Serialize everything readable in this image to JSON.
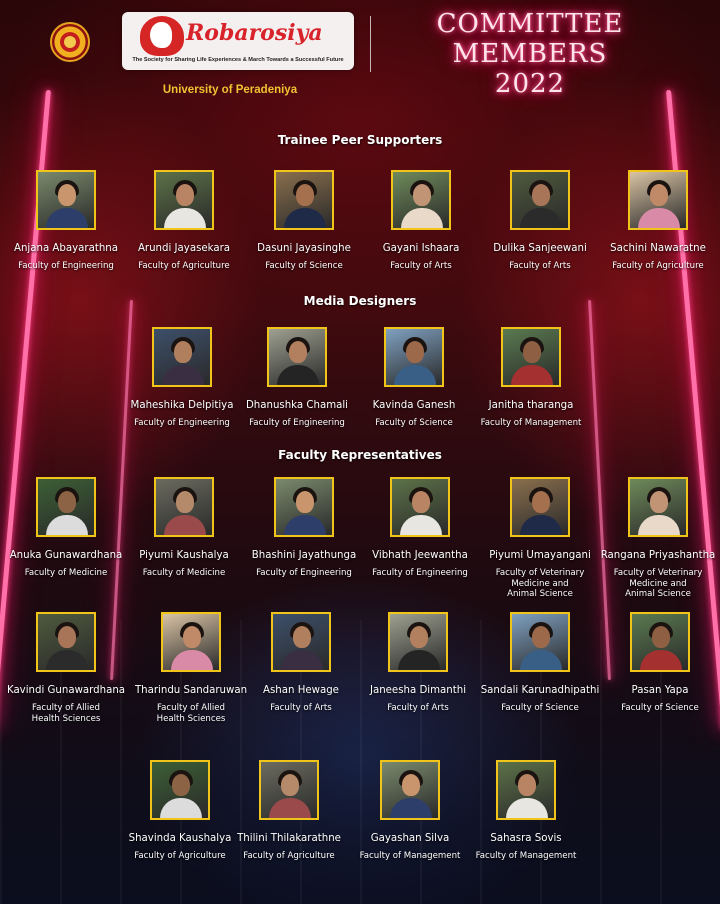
{
  "header": {
    "brand_name": "Robarosiya",
    "brand_tagline": "The Society for Sharing Life Experiences & March Towards a Successful Future",
    "university": "University of Peradeniya",
    "title_lines": [
      "COMMITTEE",
      "MEMBERS",
      "2022"
    ]
  },
  "colors": {
    "neon_pink": "#ff3d86",
    "photo_border": "#f0c419",
    "university_text": "#f2c233",
    "brand_red": "#d8232a"
  },
  "sections": {
    "trainee": {
      "title": "Trainee Peer Supporters",
      "members": [
        {
          "name": "Anjana Abayarathna",
          "faculty": "Faculty of Engineering"
        },
        {
          "name": "Arundi Jayasekara",
          "faculty": "Faculty of Agriculture"
        },
        {
          "name": "Dasuni Jayasinghe",
          "faculty": "Faculty of Science"
        },
        {
          "name": "Gayani Ishaara",
          "faculty": "Faculty of Arts"
        },
        {
          "name": "Dulika Sanjeewani",
          "faculty": "Faculty of Arts"
        },
        {
          "name": "Sachini Nawaratne",
          "faculty": "Faculty of Agriculture"
        }
      ]
    },
    "media": {
      "title": "Media Designers",
      "members": [
        {
          "name": "Maheshika Delpitiya",
          "faculty": "Faculty of Engineering"
        },
        {
          "name": "Dhanushka Chamali",
          "faculty": "Faculty of Engineering"
        },
        {
          "name": "Kavinda Ganesh",
          "faculty": "Faculty of Science"
        },
        {
          "name": "Janitha tharanga",
          "faculty": "Faculty of Management"
        }
      ]
    },
    "faculty": {
      "title": "Faculty Representatives",
      "members": [
        {
          "name": "Anuka Gunawardhana",
          "faculty": "Faculty of Medicine"
        },
        {
          "name": "Piyumi Kaushalya",
          "faculty": "Faculty of Medicine"
        },
        {
          "name": "Bhashini Jayathunga",
          "faculty": "Faculty of Engineering"
        },
        {
          "name": "Vibhath Jeewantha",
          "faculty": "Faculty of Engineering"
        },
        {
          "name": "Piyumi Umayangani",
          "faculty": "Faculty of Veterinary\nMedicine and\nAnimal Science"
        },
        {
          "name": "Rangana Priyashantha",
          "faculty": "Faculty of Veterinary\nMedicine and\nAnimal Science"
        },
        {
          "name": "Kavindi Gunawardhana",
          "faculty": "Faculty of Allied\nHealth Sciences"
        },
        {
          "name": "Tharindu Sandaruwan",
          "faculty": "Faculty of Allied\nHealth Sciences"
        },
        {
          "name": "Ashan Hewage",
          "faculty": "Faculty of Arts"
        },
        {
          "name": "Janeesha Dimanthi",
          "faculty": "Faculty of Arts"
        },
        {
          "name": "Sandali Karunadhipathi",
          "faculty": "Faculty of Science"
        },
        {
          "name": "Pasan Yapa",
          "faculty": "Faculty of Science"
        },
        {
          "name": "Shavinda Kaushalya",
          "faculty": "Faculty of Agriculture"
        },
        {
          "name": "Thilini Thilakarathne",
          "faculty": "Faculty of Agriculture"
        },
        {
          "name": "Gayashan Silva",
          "faculty": "Faculty of Management"
        },
        {
          "name": "Sahasra Sovis",
          "faculty": "Faculty of Management"
        }
      ]
    }
  }
}
